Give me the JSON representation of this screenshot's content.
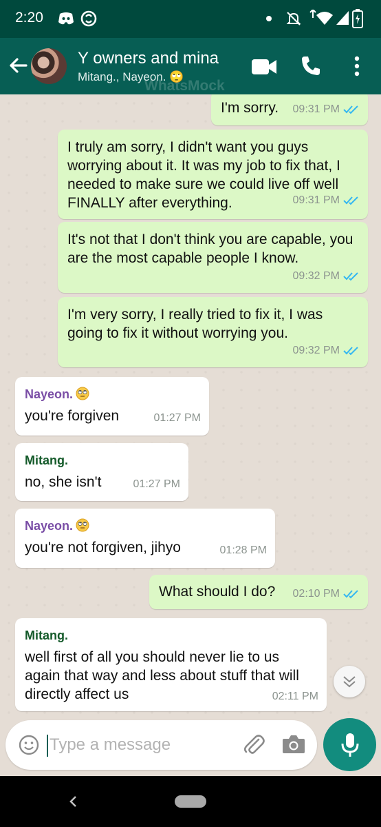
{
  "status_bar": {
    "time": "2:20"
  },
  "header": {
    "title": "Y owners and mina",
    "subtitle": "Mitang., Nayeon. 🙄",
    "watermark": "WhatsMock"
  },
  "messages": [
    {
      "dir": "out",
      "text": "I'm sorry.",
      "time": "09:31 PM"
    },
    {
      "dir": "out",
      "text": "I truly am sorry, I didn't want you guys worrying about it. It was my job to fix that, I needed to make sure we could live off well FINALLY after everything.",
      "time": "09:31 PM"
    },
    {
      "dir": "out",
      "text": "It's not that I don't think you are capable, you are the most capable people I know.",
      "time": "09:32 PM"
    },
    {
      "dir": "out",
      "text": "I'm very sorry, I really tried to fix it, I was going to fix it without worrying you.",
      "time": "09:32 PM"
    },
    {
      "dir": "in",
      "sender": "Nayeon.",
      "text": "you're forgiven",
      "time": "01:27 PM"
    },
    {
      "dir": "in",
      "sender": "Mitang.",
      "text": "no, she isn't",
      "time": "01:27 PM"
    },
    {
      "dir": "in",
      "sender": "Nayeon.",
      "text": "you're not forgiven, jihyo",
      "time": "01:28 PM"
    },
    {
      "dir": "out",
      "text": "What should I do?",
      "time": "02:10 PM"
    },
    {
      "dir": "in",
      "sender": "Mitang.",
      "text": "well first of all you should never lie to us again that way and less about stuff that will directly affect us",
      "time": "02:11 PM"
    }
  ],
  "composer": {
    "placeholder": "Type a message"
  },
  "colors": {
    "header": "#075e54",
    "status_bar": "#00493d",
    "outgoing": "#dcf8c6",
    "incoming": "#ffffff",
    "read_tick": "#34b7f1",
    "accent": "#128c7e"
  }
}
